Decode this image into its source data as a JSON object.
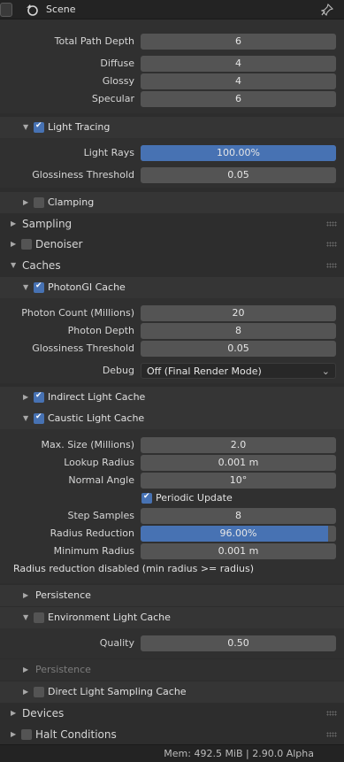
{
  "header": {
    "title": "Scene"
  },
  "path_depth": {
    "total_path_depth_label": "Total Path Depth",
    "total_path_depth": "6",
    "diffuse_label": "Diffuse",
    "diffuse": "4",
    "glossy_label": "Glossy",
    "glossy": "4",
    "specular_label": "Specular",
    "specular": "6"
  },
  "light_tracing": {
    "title": "Light Tracing",
    "enabled": true,
    "light_rays_label": "Light Rays",
    "light_rays": "100.00%",
    "light_rays_fraction": 1.0,
    "glossiness_label": "Glossiness Threshold",
    "glossiness": "0.05"
  },
  "clamping": {
    "title": "Clamping",
    "enabled": false
  },
  "sampling": {
    "title": "Sampling"
  },
  "denoiser": {
    "title": "Denoiser",
    "enabled": false
  },
  "caches": {
    "title": "Caches",
    "photongi": {
      "title": "PhotonGI Cache",
      "enabled": true,
      "photon_count_label": "Photon Count (Millions)",
      "photon_count": "20",
      "photon_depth_label": "Photon Depth",
      "photon_depth": "8",
      "glossiness_label": "Glossiness Threshold",
      "glossiness": "0.05",
      "debug_label": "Debug",
      "debug_value": "Off (Final Render Mode)"
    },
    "indirect": {
      "title": "Indirect Light Cache",
      "enabled": true
    },
    "caustic": {
      "title": "Caustic Light Cache",
      "enabled": true,
      "max_size_label": "Max. Size (Millions)",
      "max_size": "2.0",
      "lookup_radius_label": "Lookup Radius",
      "lookup_radius": "0.001 m",
      "normal_angle_label": "Normal Angle",
      "normal_angle": "10°",
      "periodic_update_label": "Periodic Update",
      "periodic_update": true,
      "step_samples_label": "Step Samples",
      "step_samples": "8",
      "radius_reduction_label": "Radius Reduction",
      "radius_reduction": "96.00%",
      "radius_reduction_fraction": 0.96,
      "minimum_radius_label": "Minimum Radius",
      "minimum_radius": "0.001 m",
      "warning": "Radius reduction disabled (min radius >= radius)"
    },
    "persistence": {
      "title": "Persistence"
    },
    "environment": {
      "title": "Environment Light Cache",
      "enabled": false,
      "quality_label": "Quality",
      "quality": "0.50",
      "persistence_title": "Persistence"
    },
    "direct": {
      "title": "Direct Light Sampling Cache",
      "enabled": false
    }
  },
  "devices": {
    "title": "Devices"
  },
  "halt": {
    "title": "Halt Conditions",
    "enabled": false
  },
  "status_bar": {
    "text": "Mem: 492.5 MiB | 2.90.0 Alpha"
  }
}
